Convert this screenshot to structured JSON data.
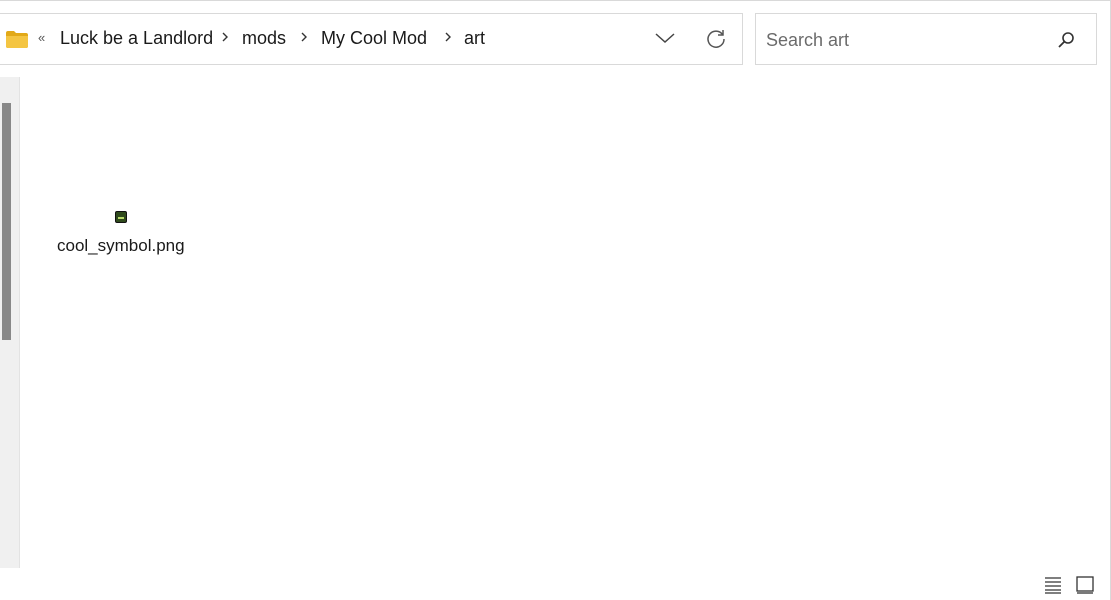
{
  "address_bar": {
    "overflow_label": "«",
    "breadcrumbs": [
      "Luck be a Landlord",
      "mods",
      "My Cool Mod",
      "art"
    ],
    "folder_icon": "folder-icon",
    "dropdown_icon": "chevron-down-icon",
    "refresh_icon": "refresh-icon"
  },
  "search": {
    "placeholder": "Search art",
    "value": "",
    "icon": "search-icon"
  },
  "files": [
    {
      "name": "cool_symbol.png",
      "icon": "png-thumbnail"
    }
  ],
  "status_bar": {
    "details_view_icon": "details-view-icon",
    "tiles_view_icon": "tiles-view-icon"
  },
  "colors": {
    "folder": "#f4c542",
    "folder_tab": "#e2a918",
    "border": "#d9d9d9",
    "nav_pane": "#f0f0f0",
    "scroll_thumb": "#888888",
    "text": "#1a1a1a"
  }
}
